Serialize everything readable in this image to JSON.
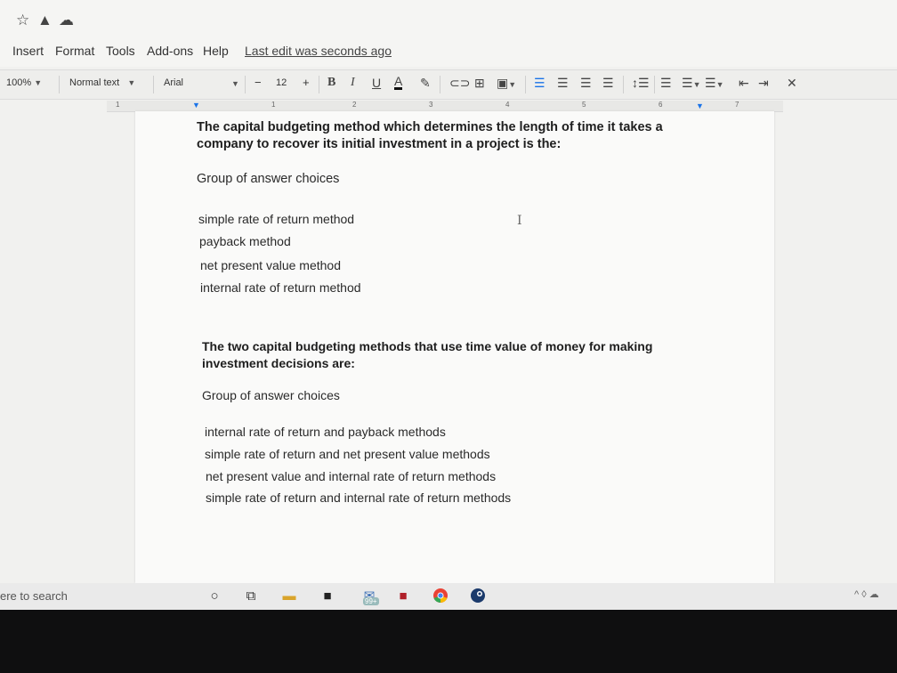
{
  "menubar": {
    "items": [
      "Insert",
      "Format",
      "Tools",
      "Add-ons",
      "Help"
    ],
    "last_edit": "Last edit was seconds ago"
  },
  "toolbar": {
    "zoom": "100%",
    "style": "Normal text",
    "font": "Arial",
    "minus": "−",
    "font_size": "12",
    "plus": "+"
  },
  "ruler": {
    "numbers": [
      "1",
      "1",
      "2",
      "3",
      "4",
      "5",
      "6",
      "7"
    ]
  },
  "document": {
    "q1_line1": "The capital budgeting method which determines the length of time it takes a",
    "q1_line2": "company to recover its initial investment in a project is the:",
    "q1_group": "Group of answer choices",
    "q1_options": [
      "simple rate of return method",
      "payback method",
      "net present value method",
      "internal rate of return method"
    ],
    "q2_line1": "The two capital budgeting methods that use time value of money for making",
    "q2_line2": "investment decisions are:",
    "q2_group": "Group of answer choices",
    "q2_options": [
      "internal rate of return and payback methods",
      "simple rate of return and net present value methods",
      "net present value and internal rate of return methods",
      "simple rate of return and internal rate of return methods"
    ]
  },
  "taskbar": {
    "search": "ere to search",
    "badge": "99+"
  },
  "colors": {
    "accent_blue": "#1a73e8"
  }
}
